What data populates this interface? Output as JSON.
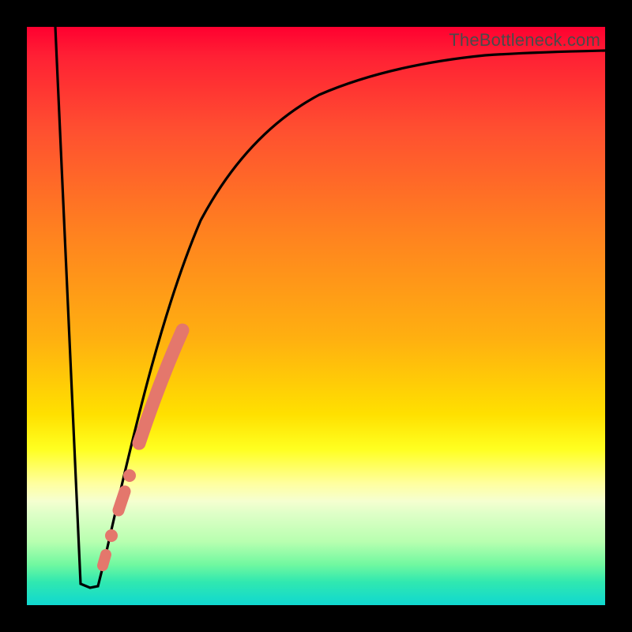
{
  "watermark_text": "TheBottleneck.com",
  "chart_data": {
    "type": "line",
    "title": "",
    "xlabel": "",
    "ylabel": "",
    "xlim": [
      0,
      100
    ],
    "ylim": [
      0,
      100
    ],
    "curve_description": "V-shaped bottleneck curve: steep linear descent from top-left to a flat minimum near x≈9–12 at y≈3, then asymptotic rise toward ~92 on the right edge",
    "series": [
      {
        "name": "bottleneck-curve",
        "x": [
          5,
          7,
          9,
          10,
          11,
          12,
          13,
          15,
          17,
          20,
          23,
          26,
          30,
          35,
          40,
          46,
          55,
          65,
          78,
          90,
          100
        ],
        "y": [
          100,
          58,
          10,
          3,
          3,
          3,
          8,
          20,
          32,
          45,
          55,
          62,
          69,
          75,
          79,
          82.5,
          86,
          88.3,
          90.1,
          91.3,
          92
        ]
      }
    ],
    "highlight_segment": {
      "name": "thick-salmon-overlay",
      "color": "#e4776c",
      "points_x": [
        12.5,
        13.2,
        13.8,
        14.3,
        15.0,
        15.6,
        16.3,
        17.0,
        18.0,
        19.0,
        20.0,
        21.2,
        22.4,
        23.5
      ],
      "points_y": [
        5.0,
        8.0,
        11.0,
        13.5,
        17.5,
        21.0,
        24.5,
        28.5,
        33.5,
        39.0,
        44.0,
        49.5,
        54.0,
        57.5
      ]
    }
  }
}
